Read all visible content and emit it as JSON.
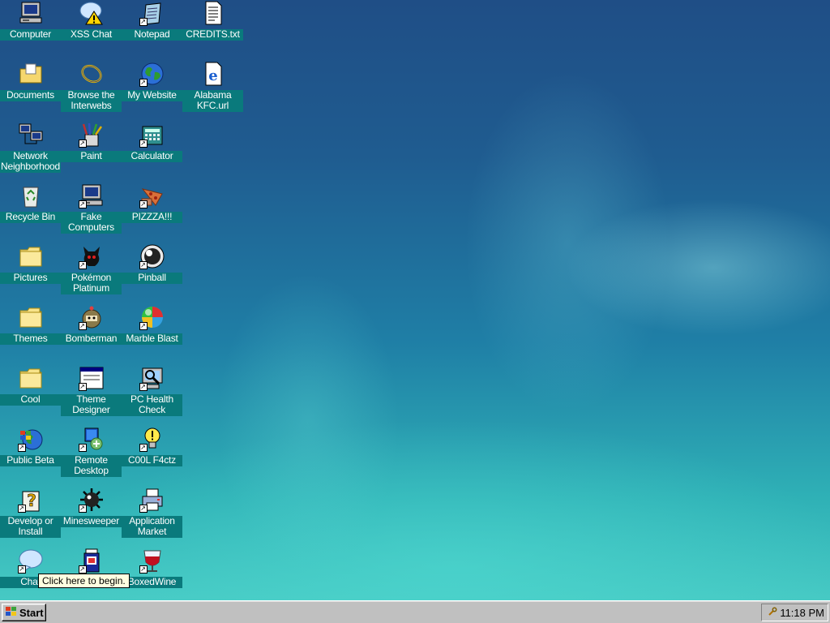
{
  "desktop_icons": [
    {
      "id": "computer",
      "label": "Computer",
      "icon": "computer-icon",
      "shortcut": false
    },
    {
      "id": "xss-chat",
      "label": "XSS Chat",
      "icon": "chat-warning-icon",
      "shortcut": false
    },
    {
      "id": "notepad",
      "label": "Notepad",
      "icon": "notepad-icon",
      "shortcut": true
    },
    {
      "id": "credits",
      "label": "CREDITS.txt",
      "icon": "text-file-icon",
      "shortcut": false
    },
    {
      "id": "documents",
      "label": "Documents",
      "icon": "documents-folder-icon",
      "shortcut": false
    },
    {
      "id": "browse",
      "label": "Browse the\nInterwebs",
      "icon": "internet-loop-icon",
      "shortcut": false
    },
    {
      "id": "my-website",
      "label": "My Website",
      "icon": "globe-icon",
      "shortcut": true
    },
    {
      "id": "alabama-kfc",
      "label": "Alabama\nKFC.url",
      "icon": "internet-shortcut-icon",
      "shortcut": false
    },
    {
      "id": "network",
      "label": "Network\nNeighborhood",
      "icon": "network-icon",
      "shortcut": false
    },
    {
      "id": "paint",
      "label": "Paint",
      "icon": "paint-icon",
      "shortcut": true
    },
    {
      "id": "calculator",
      "label": "Calculator",
      "icon": "calculator-icon",
      "shortcut": true
    },
    {
      "id": "recycle-bin",
      "label": "Recycle Bin",
      "icon": "recycle-bin-icon",
      "shortcut": false
    },
    {
      "id": "fake-computers",
      "label": "Fake\nComputers",
      "icon": "computer-icon",
      "shortcut": true
    },
    {
      "id": "pizza",
      "label": "PIZZZA!!!",
      "icon": "pizza-icon",
      "shortcut": true
    },
    {
      "id": "pictures",
      "label": "Pictures",
      "icon": "folder-icon",
      "shortcut": false
    },
    {
      "id": "pokemon",
      "label": "Pokémon\nPlatinum",
      "icon": "pokemon-icon",
      "shortcut": true
    },
    {
      "id": "pinball",
      "label": "Pinball",
      "icon": "pinball-icon",
      "shortcut": true
    },
    {
      "id": "themes",
      "label": "Themes",
      "icon": "folder-icon",
      "shortcut": false
    },
    {
      "id": "bomberman",
      "label": "Bomberman",
      "icon": "bomberman-icon",
      "shortcut": true
    },
    {
      "id": "marble-blast",
      "label": "Marble Blast",
      "icon": "marble-icon",
      "shortcut": true
    },
    {
      "id": "cool",
      "label": "Cool",
      "icon": "folder-icon",
      "shortcut": false
    },
    {
      "id": "theme-designer",
      "label": "Theme\nDesigner",
      "icon": "window-icon",
      "shortcut": true
    },
    {
      "id": "pc-health",
      "label": "PC Health\nCheck",
      "icon": "health-check-icon",
      "shortcut": true
    },
    {
      "id": "public-beta",
      "label": "Public Beta",
      "icon": "windows-globe-icon",
      "shortcut": true
    },
    {
      "id": "remote-desktop",
      "label": "Remote\nDesktop",
      "icon": "remote-desktop-icon",
      "shortcut": true
    },
    {
      "id": "cool-facts",
      "label": "C00L F4ctz",
      "icon": "lightbulb-icon",
      "shortcut": true
    },
    {
      "id": "develop-install",
      "label": "Develop or\nInstall",
      "icon": "help-icon",
      "shortcut": true
    },
    {
      "id": "minesweeper",
      "label": "Minesweeper",
      "icon": "mine-icon",
      "shortcut": true
    },
    {
      "id": "app-market",
      "label": "Application\nMarket",
      "icon": "printer-icon",
      "shortcut": true
    },
    {
      "id": "chat",
      "label": "Chat",
      "icon": "chat-bubble-icon",
      "shortcut": true
    },
    {
      "id": "jar",
      "label": "",
      "icon": "java-jar-icon",
      "shortcut": true
    },
    {
      "id": "boxedwine",
      "label": "BoxedWine",
      "icon": "wine-glass-icon",
      "shortcut": true
    }
  ],
  "tooltip": {
    "text": "Click here to begin."
  },
  "taskbar": {
    "start_label": "Start",
    "clock": "11:18 PM"
  },
  "colors": {
    "icon_label_bg": "#0a7a7c",
    "taskbar_bg": "#c0c0c0",
    "tooltip_bg": "#ffffe1"
  }
}
